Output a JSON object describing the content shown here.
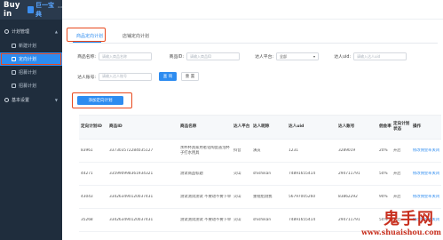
{
  "brand": {
    "name": "Buy in",
    "cn": "巨一宝典",
    "sup": "2.0"
  },
  "sidebar": {
    "group1": {
      "label": "计划管理",
      "icon": "settings-icon"
    },
    "items": [
      {
        "label": "新建计划",
        "icon": "document-icon"
      },
      {
        "label": "定向计划",
        "icon": "target-icon",
        "active": true
      },
      {
        "label": "招募计划",
        "icon": "list-icon"
      },
      {
        "label": "招募计划",
        "icon": "list-icon"
      }
    ],
    "group2": {
      "label": "基本设置",
      "icon": "gear-icon"
    }
  },
  "tabs": [
    {
      "label": "商品定向计划",
      "active": true
    },
    {
      "label": "店铺定向计划",
      "active": false
    }
  ],
  "filters": {
    "product_name": {
      "label": "商品名称:",
      "placeholder": "请输入商品名称"
    },
    "product_id": {
      "label": "商品ID:",
      "placeholder": "请输入商品ID"
    },
    "platform": {
      "label": "达人平台:",
      "value": "全部"
    },
    "uid": {
      "label": "达人uid:",
      "placeholder": "请输入达人uid"
    },
    "account": {
      "label": "达人账号:",
      "placeholder": "请输入达人账号"
    },
    "query_button": "查 询",
    "reset_button": "重 置"
  },
  "add_button": "添加定向计划",
  "table": {
    "headers": [
      "定向计划ID",
      "商品ID",
      "商品名称",
      "达人平台",
      "达人昵称",
      "达人uid",
      "达人账号",
      "佣金率",
      "定向计划状态",
      "操作"
    ],
    "rows": [
      [
        "83961",
        "337303572284035127",
        "水杯杯具家用者铝陶瓷盖泡杯子打水用具",
        "抖音",
        "演员",
        "1231",
        "3289019",
        "20%",
        "开启",
        "修改佣金率关闭"
      ],
      [
        "44271",
        "335990998361934321",
        "测试商品标题",
        "火山",
        "shishikan",
        "74891655414",
        "294711791",
        "50%",
        "开启",
        "修改佣金率关闭"
      ],
      [
        "43043",
        "334263490120037431",
        "测试测试测试 不要动不要下单",
        "火山",
        "重视组测我",
        "56797005260",
        "83862292",
        "90%",
        "开启",
        "修改佣金率关闭"
      ],
      [
        "35268",
        "334263490120037431",
        "测试测试测试 不要动不要下单",
        "火山",
        "shishikan",
        "74891655414",
        "294711791",
        "50%",
        "开启",
        "修改佣金率关闭"
      ]
    ]
  },
  "watermark": {
    "title": "鬼手网",
    "url": "www.shuaishou.com"
  },
  "colors": {
    "accent": "#2d8cf0",
    "sidebar": "#1f2d3d",
    "highlight": "#e8491d",
    "watermark": "#c8301f"
  }
}
